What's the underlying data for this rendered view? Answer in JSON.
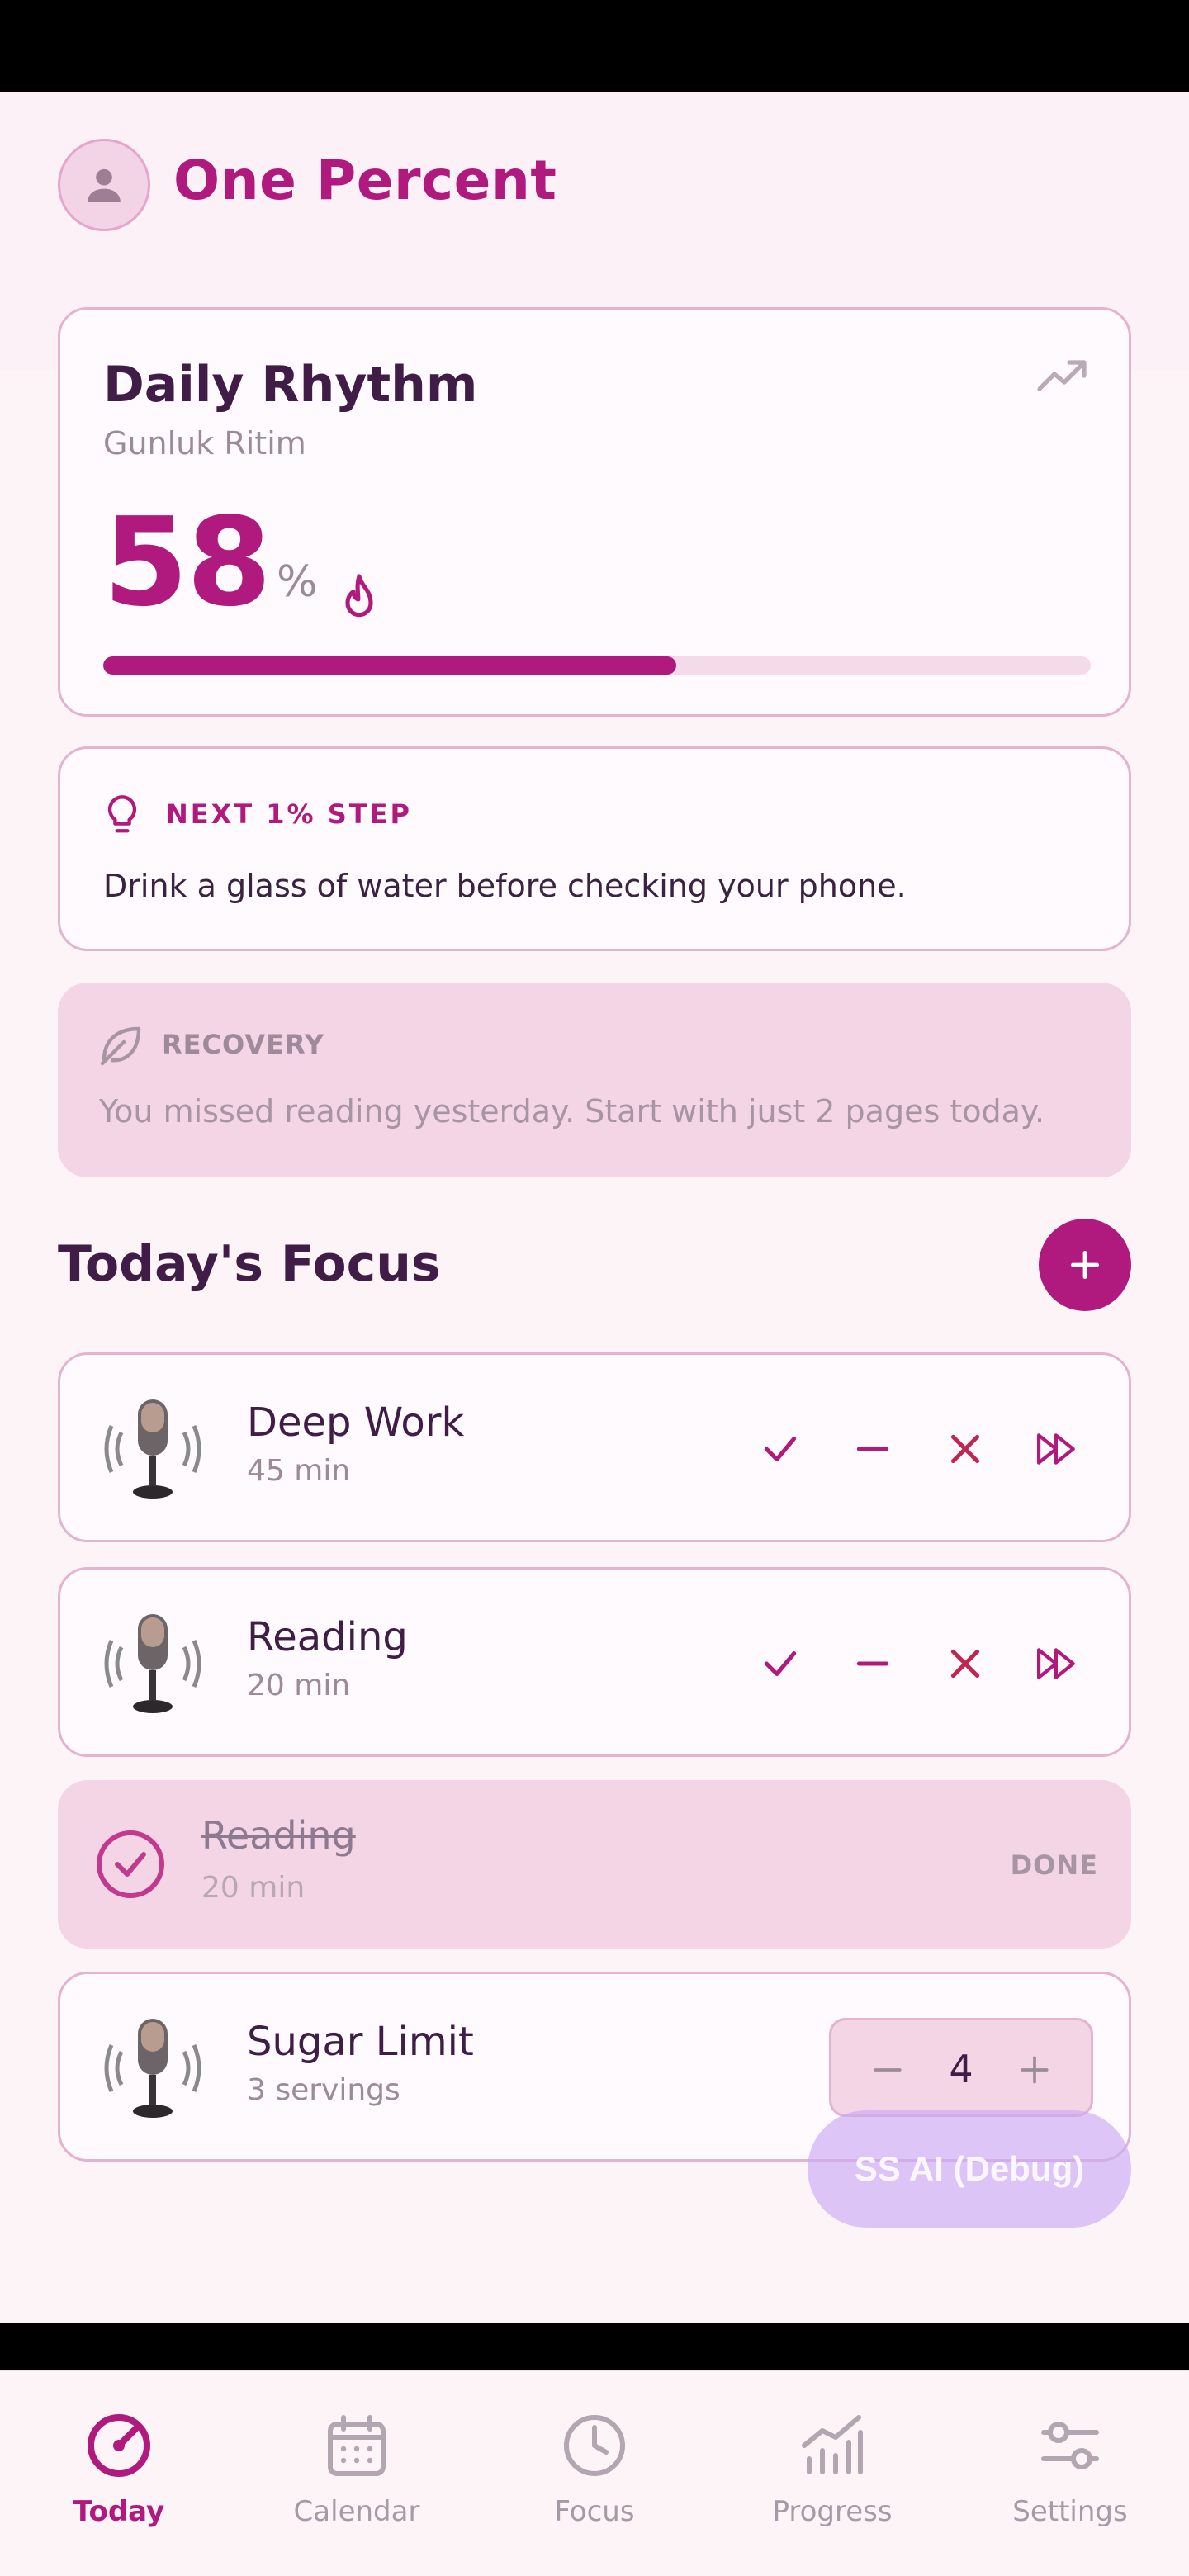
{
  "header": {
    "title": "One Percent"
  },
  "rhythm": {
    "title": "Daily Rhythm",
    "subtitle": "Gunluk Ritim",
    "value": "58",
    "unit": "%",
    "progress_fraction": 0.58
  },
  "next_step": {
    "label": "NEXT 1% STEP",
    "text": "Drink a glass of water before checking your phone."
  },
  "recovery": {
    "label": "RECOVERY",
    "text": "You missed reading yesterday. Start with just 2 pages today."
  },
  "focus": {
    "title": "Today's Focus",
    "habits": [
      {
        "name": "Deep Work",
        "detail": "45 min"
      },
      {
        "name": "Reading",
        "detail": "20 min"
      }
    ],
    "done": {
      "name": "Reading",
      "detail": "20 min",
      "status": "DONE"
    },
    "counter": {
      "name": "Sugar Limit",
      "detail": "3 servings",
      "value": "4"
    }
  },
  "debug_button": {
    "label": "SS AI (Debug)"
  },
  "bottom_nav": [
    {
      "label": "Today",
      "active": true
    },
    {
      "label": "Calendar",
      "active": false
    },
    {
      "label": "Focus",
      "active": false
    },
    {
      "label": "Progress",
      "active": false
    },
    {
      "label": "Settings",
      "active": false
    }
  ],
  "colors": {
    "accent": "#b0197d",
    "background": "#fcf1f6",
    "recovery_bg": "#f3d5e6",
    "skip_red": "#c0264f"
  }
}
